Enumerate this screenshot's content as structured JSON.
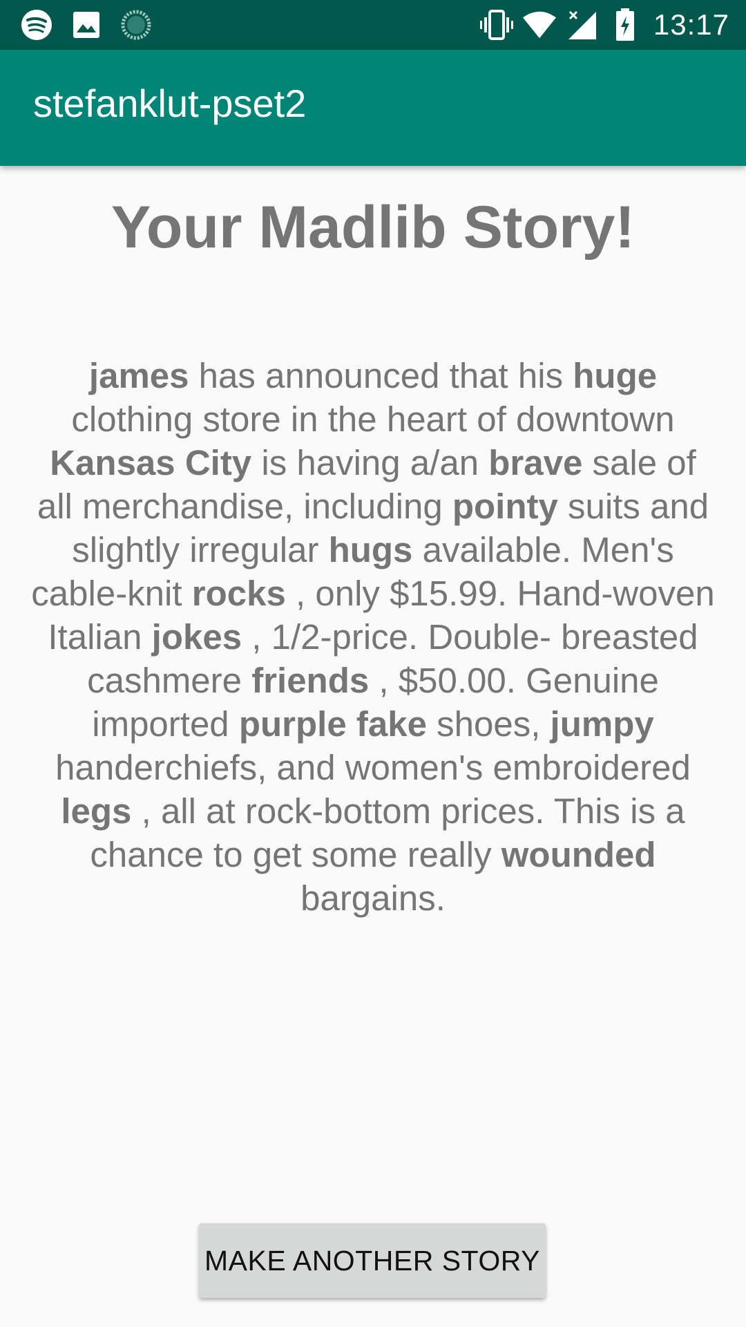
{
  "status_bar": {
    "time": "13:17",
    "left_icons": [
      "spotify-icon",
      "image-icon",
      "loading-icon"
    ],
    "right_icons": [
      "vibrate-icon",
      "wifi-icon",
      "signal-icon",
      "battery-charging-icon"
    ]
  },
  "app_bar": {
    "title": "stefanklut-pset2"
  },
  "main": {
    "heading": "Your Madlib Story!",
    "story": {
      "t0": "james",
      "t1": " has announced that his ",
      "t2": "huge",
      "t3": " clothing store in the heart of downtown ",
      "t4": "Kansas City",
      "t5": " is having a/an ",
      "t6": "brave",
      "t7": " sale of all merchandise, including ",
      "t8": "pointy",
      "t9": " suits and slightly irregular ",
      "t10": "hugs",
      "t11": " available. Men's cable-knit ",
      "t12": "rocks",
      "t13": " , only $15.99. Hand-woven Italian ",
      "t14": "jokes",
      "t15": " , 1/2-price. Double- breasted cashmere ",
      "t16": "friends",
      "t17": " , $50.00. Genuine imported ",
      "t18": "purple fake",
      "t19": " shoes, ",
      "t20": "jumpy",
      "t21": " handerchiefs, and women's embroidered ",
      "t22": "legs",
      "t23": " , all at rock-bottom prices. This is a chance to get some really ",
      "t24": "wounded",
      "t25": " bargains."
    },
    "button_label": "MAKE ANOTHER STORY"
  },
  "colors": {
    "status_bar": "#00574b",
    "app_bar": "#008577",
    "background": "#fafafa",
    "text_gray": "#757575",
    "button_bg": "#d6d7d7"
  }
}
